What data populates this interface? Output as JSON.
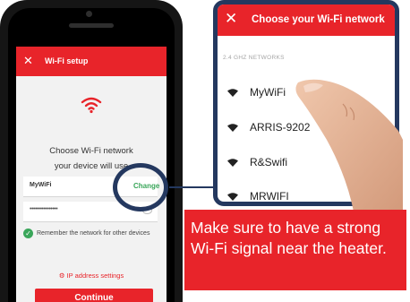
{
  "colors": {
    "brand_red": "#e8242a",
    "navy": "#24385f",
    "success_green": "#3aa65a"
  },
  "app": {
    "header_title": "Wi-Fi setup",
    "close_icon": "close-icon",
    "wifi_icon": "wifi-icon",
    "choose_line1": "Choose Wi-Fi network",
    "choose_line2": "your device will use",
    "ssid_value": "MyWiFi",
    "change_label": "Change",
    "password_mask": "••••••••••••••••",
    "remember_label": "Remember the network for other devices",
    "ip_settings_label": "IP address settings",
    "continue_label": "Continue"
  },
  "zoom": {
    "title": "Choose your Wi-Fi network",
    "section_label": "2.4 GHZ NETWORKS",
    "networks": [
      {
        "name": "MyWiFi"
      },
      {
        "name": "ARRIS-9202"
      },
      {
        "name": "R&Swifi"
      },
      {
        "name": "MRWIFI"
      }
    ]
  },
  "banner": {
    "text": "Make sure to have a strong Wi-Fi signal near the heater."
  }
}
